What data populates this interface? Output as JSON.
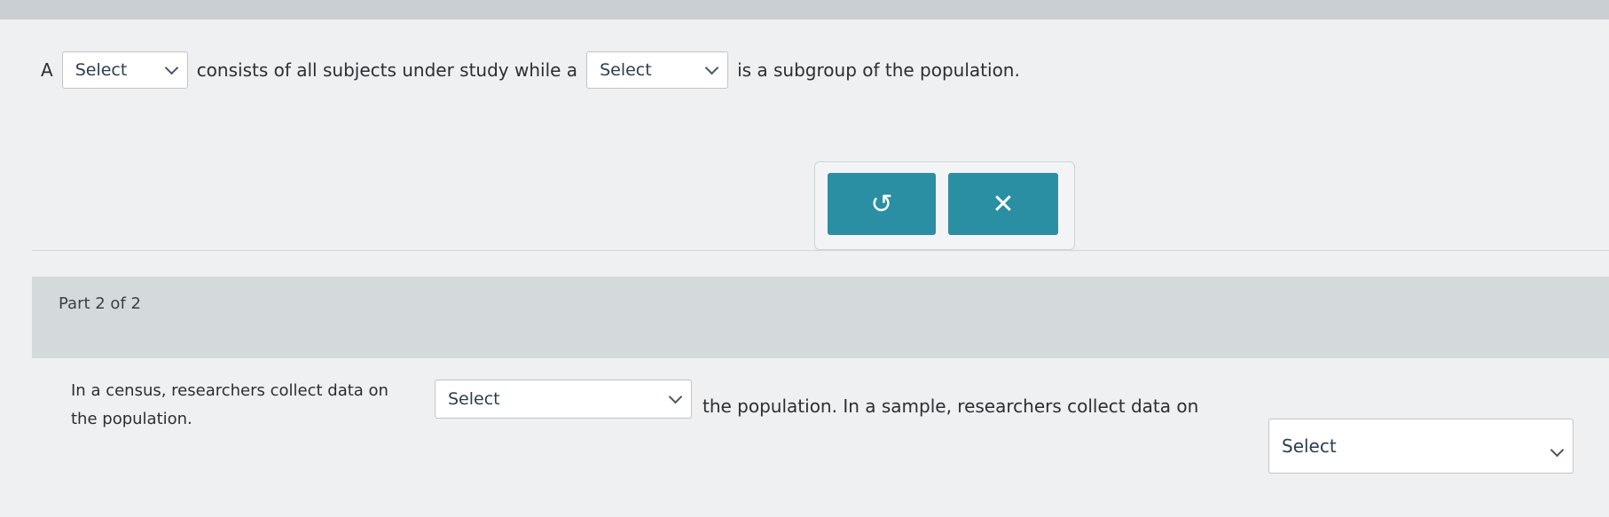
{
  "part1": {
    "lead": "A",
    "select_1": "Select",
    "text_1": "consists of all subjects under study while a",
    "select_2": "Select",
    "text_2": "is a subgroup of the population."
  },
  "buttons": {
    "undo_glyph": "↺",
    "clear_glyph": "✕",
    "color": "#2a8fa3"
  },
  "part2": {
    "label": "Part 2 of 2",
    "text_1": "In a census, researchers collect data on",
    "select_1": "Select",
    "text_1b": "the population.",
    "text_2": "the population. In a sample, researchers collect data on",
    "select_2": "Select"
  }
}
